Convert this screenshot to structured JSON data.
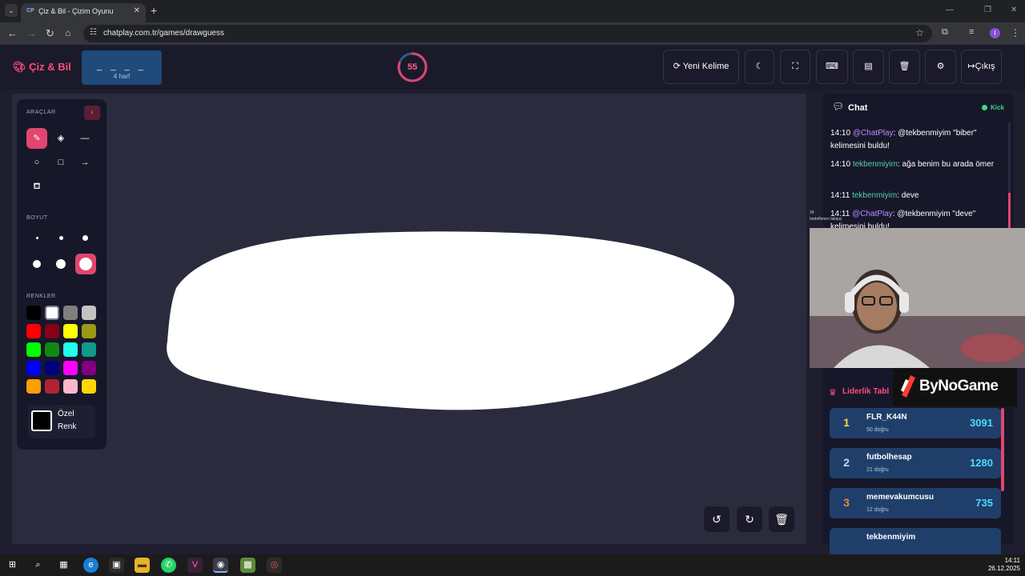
{
  "browser": {
    "tab_title": "Çiz & Bil - Çizim Oyunu",
    "tab_favicon": "CP",
    "url": "chatplay.com.tr/games/drawguess",
    "profile_initial": "I"
  },
  "header": {
    "logo": "Çiz & Bil",
    "word_hint": "_ _ _ _",
    "word_length": "4 harf",
    "timer": "55",
    "timer_progress": 0.8,
    "new_word_label": "Yeni Kelime",
    "exit_label": "Çıkış"
  },
  "toolbox": {
    "tools_title": "ARAÇLAR",
    "size_title": "BOYUT",
    "colors_title": "RENKLER",
    "custom_color_label": "Özel Renk",
    "selected_size_index": 5,
    "colors": [
      "#000000",
      "#ffffff",
      "#7f7f7f",
      "#c3c3c3",
      "#ff0000",
      "#880015",
      "#ffff00",
      "#9a9a16",
      "#00ff00",
      "#118811",
      "#22ffee",
      "#11998a",
      "#0000ff",
      "#00007f",
      "#ff00ff",
      "#800080",
      "#ff9e00",
      "#b22234",
      "#ffb6c8",
      "#ffd700"
    ]
  },
  "chat": {
    "title": "Chat",
    "platform": "Kick",
    "messages": [
      {
        "time": "14:10",
        "user": "@ChatPlay",
        "text": ": @tekbenmiyim \"biber\" kelimesini buldu!",
        "kind": "bot"
      },
      {
        "time": "14:10",
        "user": "tekbenmiyim",
        "text": ": ağa benim bu arada ömer",
        "kind": "user"
      },
      {
        "time": "14:11",
        "user": "tekbenmiyim",
        "text": ": deve",
        "kind": "user"
      },
      {
        "time": "14:11",
        "user": "@ChatPlay",
        "text": ": @tekbenmiyim \"deve\" kelimesini buldu!",
        "kind": "bot"
      }
    ]
  },
  "overlay": {
    "number": "34",
    "caption": "hedeflenen takipçi"
  },
  "leaderboard": {
    "title": "Liderlik Tabl",
    "sponsor": "ByNoGame",
    "rows": [
      {
        "rank": "1",
        "name": "FLR_K44N",
        "sub": "50 doğru",
        "score": "3091",
        "rank_color": "#ffd23f"
      },
      {
        "rank": "2",
        "name": "futbolhesap",
        "sub": "21 doğru",
        "score": "1280",
        "rank_color": "#c9d6e8"
      },
      {
        "rank": "3",
        "name": "memevakumcusu",
        "sub": "12 doğru",
        "score": "735",
        "rank_color": "#e08a3c"
      },
      {
        "rank": "",
        "name": "tekbenmiyim",
        "sub": "",
        "score": "",
        "rank_color": "#ffffff"
      }
    ]
  },
  "taskbar": {
    "time": "14:11",
    "date": "26.12.2025"
  }
}
